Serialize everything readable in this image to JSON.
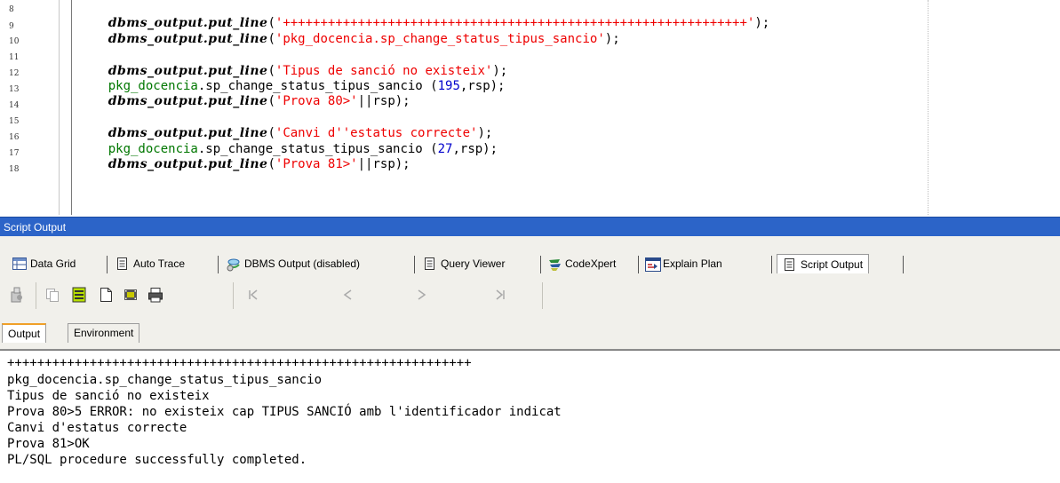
{
  "editor": {
    "line_numbers": [
      "8",
      "9",
      "10",
      "11",
      "12",
      "13",
      "14",
      "15",
      "16",
      "17",
      "18"
    ],
    "lines": [
      {
        "kw": "dbms_output.put_line",
        "open": "(",
        "str": "'++++++++++++++++++++++++++++++++++++++++++++++++++++++++++++++'",
        "close": ");"
      },
      {
        "kw": "dbms_output.put_line",
        "open": "(",
        "str": "'pkg_docencia.sp_change_status_tipus_sancio'",
        "close": ");"
      },
      {
        "kw": "dbms_output.put_line",
        "open": "(",
        "str": "'Tipus de sanció no existeix'",
        "close": ");"
      },
      {
        "pkg": "pkg_docencia",
        "rest": ".sp_change_status_tipus_sancio ",
        "args_open": "(",
        "num": "195",
        "args_rest": ",rsp);"
      },
      {
        "kw": "dbms_output.put_line",
        "open": "(",
        "str": "'Prova 80>'",
        "close": "||rsp);"
      },
      {
        "kw": "dbms_output.put_line",
        "open": "(",
        "str": "'Canvi d''estatus correcte'",
        "close": ");"
      },
      {
        "pkg": "pkg_docencia",
        "rest": ".sp_change_status_tipus_sancio ",
        "args_open": "(",
        "num": "27",
        "args_rest": ",rsp);"
      },
      {
        "kw": "dbms_output.put_line",
        "open": "(",
        "str": "'Prova 81>'",
        "close": "||rsp);"
      }
    ]
  },
  "panel": {
    "title": "Script Output"
  },
  "tabs": [
    {
      "label": "Data Grid",
      "icon": "data-grid-icon"
    },
    {
      "label": "Auto Trace",
      "icon": "document-icon"
    },
    {
      "label": "DBMS Output (disabled)",
      "icon": "dbms-output-icon"
    },
    {
      "label": "Query Viewer",
      "icon": "document-icon"
    },
    {
      "label": "CodeXpert",
      "icon": "codexpert-icon"
    },
    {
      "label": "Explain Plan",
      "icon": "explain-plan-icon"
    },
    {
      "label": "Script Output",
      "icon": "document-icon"
    }
  ],
  "subtabs": [
    "Output",
    "Environment"
  ],
  "output": {
    "lines": [
      "++++++++++++++++++++++++++++++++++++++++++++++++++++++++++++++",
      "pkg_docencia.sp_change_status_tipus_sancio",
      "Tipus de sanció no existeix",
      "Prova 80>5 ERROR: no existeix cap TIPUS SANCIÓ amb l'identificador indicat",
      "Canvi d'estatus correcte",
      "Prova 81>OK",
      "PL/SQL procedure successfully completed."
    ]
  },
  "colors": {
    "title_bar": "#2c64c8",
    "keyword": "#000000",
    "string": "#ee0000",
    "package": "#007700",
    "number": "#0000cc",
    "toolbar_bg": "#f1f0eb"
  }
}
